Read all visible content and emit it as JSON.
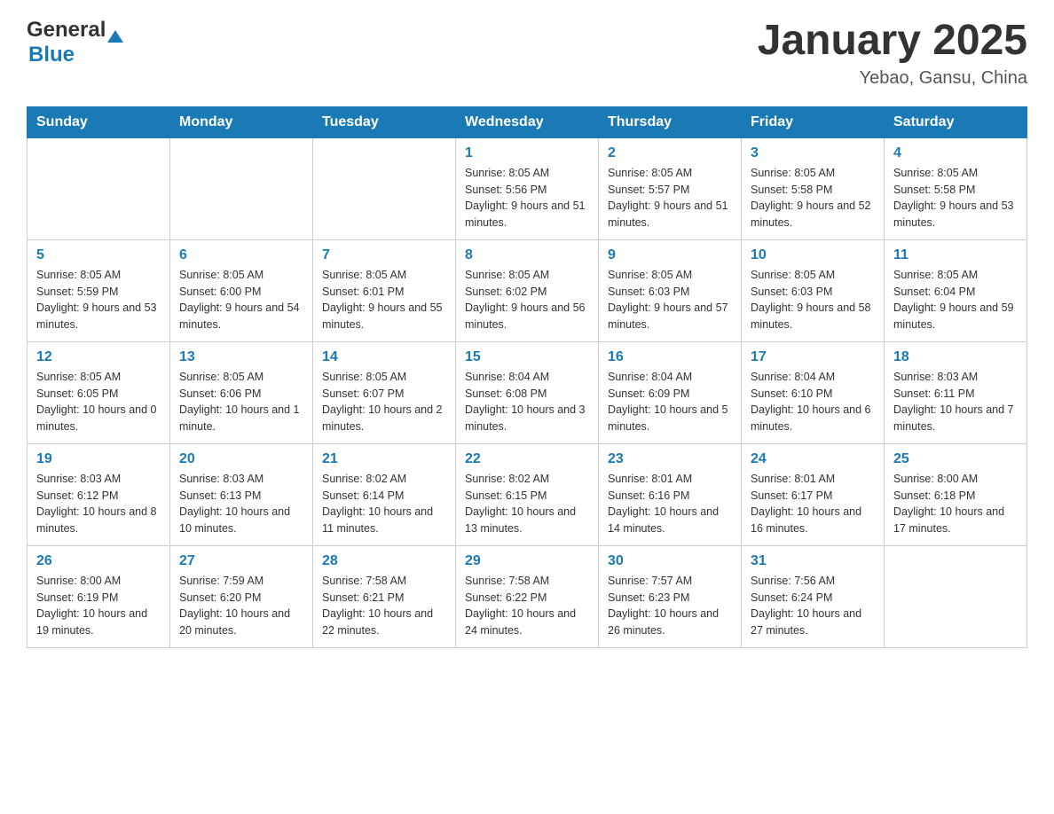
{
  "header": {
    "logo_general": "General",
    "logo_blue": "Blue",
    "title": "January 2025",
    "subtitle": "Yebao, Gansu, China"
  },
  "days_of_week": [
    "Sunday",
    "Monday",
    "Tuesday",
    "Wednesday",
    "Thursday",
    "Friday",
    "Saturday"
  ],
  "weeks": [
    [
      {
        "day": "",
        "info": ""
      },
      {
        "day": "",
        "info": ""
      },
      {
        "day": "",
        "info": ""
      },
      {
        "day": "1",
        "info": "Sunrise: 8:05 AM\nSunset: 5:56 PM\nDaylight: 9 hours\nand 51 minutes."
      },
      {
        "day": "2",
        "info": "Sunrise: 8:05 AM\nSunset: 5:57 PM\nDaylight: 9 hours\nand 51 minutes."
      },
      {
        "day": "3",
        "info": "Sunrise: 8:05 AM\nSunset: 5:58 PM\nDaylight: 9 hours\nand 52 minutes."
      },
      {
        "day": "4",
        "info": "Sunrise: 8:05 AM\nSunset: 5:58 PM\nDaylight: 9 hours\nand 53 minutes."
      }
    ],
    [
      {
        "day": "5",
        "info": "Sunrise: 8:05 AM\nSunset: 5:59 PM\nDaylight: 9 hours\nand 53 minutes."
      },
      {
        "day": "6",
        "info": "Sunrise: 8:05 AM\nSunset: 6:00 PM\nDaylight: 9 hours\nand 54 minutes."
      },
      {
        "day": "7",
        "info": "Sunrise: 8:05 AM\nSunset: 6:01 PM\nDaylight: 9 hours\nand 55 minutes."
      },
      {
        "day": "8",
        "info": "Sunrise: 8:05 AM\nSunset: 6:02 PM\nDaylight: 9 hours\nand 56 minutes."
      },
      {
        "day": "9",
        "info": "Sunrise: 8:05 AM\nSunset: 6:03 PM\nDaylight: 9 hours\nand 57 minutes."
      },
      {
        "day": "10",
        "info": "Sunrise: 8:05 AM\nSunset: 6:03 PM\nDaylight: 9 hours\nand 58 minutes."
      },
      {
        "day": "11",
        "info": "Sunrise: 8:05 AM\nSunset: 6:04 PM\nDaylight: 9 hours\nand 59 minutes."
      }
    ],
    [
      {
        "day": "12",
        "info": "Sunrise: 8:05 AM\nSunset: 6:05 PM\nDaylight: 10 hours\nand 0 minutes."
      },
      {
        "day": "13",
        "info": "Sunrise: 8:05 AM\nSunset: 6:06 PM\nDaylight: 10 hours\nand 1 minute."
      },
      {
        "day": "14",
        "info": "Sunrise: 8:05 AM\nSunset: 6:07 PM\nDaylight: 10 hours\nand 2 minutes."
      },
      {
        "day": "15",
        "info": "Sunrise: 8:04 AM\nSunset: 6:08 PM\nDaylight: 10 hours\nand 3 minutes."
      },
      {
        "day": "16",
        "info": "Sunrise: 8:04 AM\nSunset: 6:09 PM\nDaylight: 10 hours\nand 5 minutes."
      },
      {
        "day": "17",
        "info": "Sunrise: 8:04 AM\nSunset: 6:10 PM\nDaylight: 10 hours\nand 6 minutes."
      },
      {
        "day": "18",
        "info": "Sunrise: 8:03 AM\nSunset: 6:11 PM\nDaylight: 10 hours\nand 7 minutes."
      }
    ],
    [
      {
        "day": "19",
        "info": "Sunrise: 8:03 AM\nSunset: 6:12 PM\nDaylight: 10 hours\nand 8 minutes."
      },
      {
        "day": "20",
        "info": "Sunrise: 8:03 AM\nSunset: 6:13 PM\nDaylight: 10 hours\nand 10 minutes."
      },
      {
        "day": "21",
        "info": "Sunrise: 8:02 AM\nSunset: 6:14 PM\nDaylight: 10 hours\nand 11 minutes."
      },
      {
        "day": "22",
        "info": "Sunrise: 8:02 AM\nSunset: 6:15 PM\nDaylight: 10 hours\nand 13 minutes."
      },
      {
        "day": "23",
        "info": "Sunrise: 8:01 AM\nSunset: 6:16 PM\nDaylight: 10 hours\nand 14 minutes."
      },
      {
        "day": "24",
        "info": "Sunrise: 8:01 AM\nSunset: 6:17 PM\nDaylight: 10 hours\nand 16 minutes."
      },
      {
        "day": "25",
        "info": "Sunrise: 8:00 AM\nSunset: 6:18 PM\nDaylight: 10 hours\nand 17 minutes."
      }
    ],
    [
      {
        "day": "26",
        "info": "Sunrise: 8:00 AM\nSunset: 6:19 PM\nDaylight: 10 hours\nand 19 minutes."
      },
      {
        "day": "27",
        "info": "Sunrise: 7:59 AM\nSunset: 6:20 PM\nDaylight: 10 hours\nand 20 minutes."
      },
      {
        "day": "28",
        "info": "Sunrise: 7:58 AM\nSunset: 6:21 PM\nDaylight: 10 hours\nand 22 minutes."
      },
      {
        "day": "29",
        "info": "Sunrise: 7:58 AM\nSunset: 6:22 PM\nDaylight: 10 hours\nand 24 minutes."
      },
      {
        "day": "30",
        "info": "Sunrise: 7:57 AM\nSunset: 6:23 PM\nDaylight: 10 hours\nand 26 minutes."
      },
      {
        "day": "31",
        "info": "Sunrise: 7:56 AM\nSunset: 6:24 PM\nDaylight: 10 hours\nand 27 minutes."
      },
      {
        "day": "",
        "info": ""
      }
    ]
  ]
}
